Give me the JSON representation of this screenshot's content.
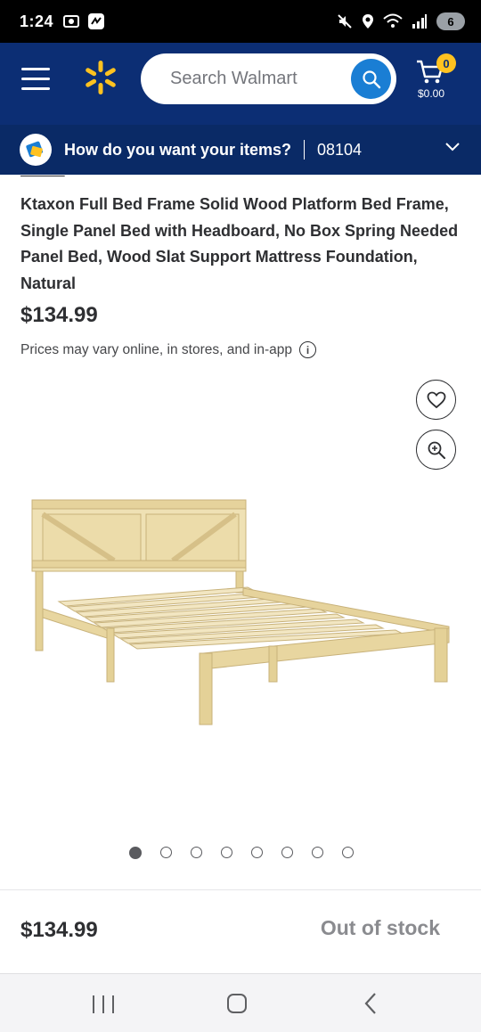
{
  "status_bar": {
    "time": "1:24",
    "battery": "6"
  },
  "header": {
    "search_placeholder": "Search Walmart",
    "cart_count": "0",
    "cart_total": "$0.00"
  },
  "delivery": {
    "question": "How do you want your items?",
    "zip": "08104"
  },
  "product": {
    "brand": "Ktaxon",
    "title": "Ktaxon Full Bed Frame Solid Wood Platform Bed Frame, Single Panel Bed with Headboard, No Box Spring Needed Panel Bed, Wood Slat Support Mattress Foundation, Natural",
    "price": "$134.99",
    "price_note": "Prices may vary online, in stores, and in-app",
    "image_count": 8,
    "active_image": 1
  },
  "footer": {
    "price": "$134.99",
    "availability": "Out of stock"
  },
  "colors": {
    "header_bg": "#0c2e74",
    "accent_blue": "#1a7ed4",
    "spark_yellow": "#ffc220"
  }
}
